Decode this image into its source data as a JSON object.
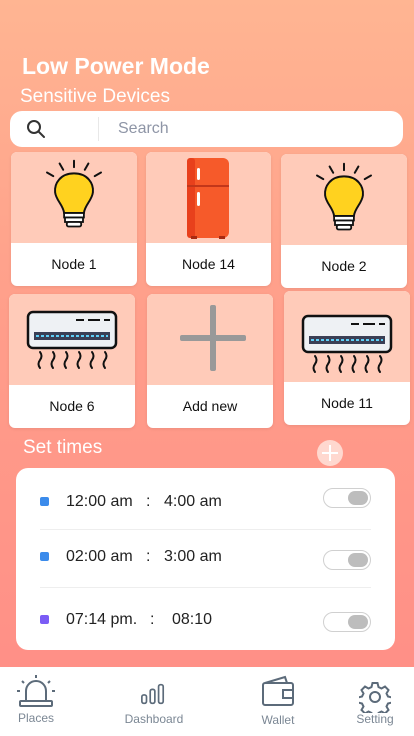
{
  "header": {
    "title": "Low Power Mode",
    "subtitle": "Sensitive Devices"
  },
  "search": {
    "placeholder": "Search",
    "value": ""
  },
  "devices": [
    {
      "label": "Node 1",
      "icon": "lightbulb-icon"
    },
    {
      "label": "Node 14",
      "icon": "refrigerator-icon"
    },
    {
      "label": "Node 2",
      "icon": "lightbulb-icon"
    },
    {
      "label": "Node 6",
      "icon": "air-conditioner-icon"
    },
    {
      "label": "Add new",
      "icon": "plus-icon"
    },
    {
      "label": "Node 11",
      "icon": "air-conditioner-icon"
    }
  ],
  "schedule": {
    "title": "Set times",
    "add_icon": "plus-circle-icon",
    "rows": [
      {
        "start": "12:00 am",
        "separator": ":",
        "end": "4:00 am",
        "color": "#3b8beb",
        "enabled": false
      },
      {
        "start": "02:00 am",
        "separator": ":",
        "end": "3:00 am",
        "color": "#3b8beb",
        "enabled": false
      },
      {
        "start": "07:14 pm.",
        "separator": ":",
        "end": "08:10",
        "color": "#7b5cf5",
        "enabled": false
      }
    ]
  },
  "tabs": [
    {
      "label": "Places",
      "icon": "alarm-light-icon"
    },
    {
      "label": "Dashboard",
      "icon": "bar-chart-icon"
    },
    {
      "label": "Wallet",
      "icon": "wallet-icon"
    },
    {
      "label": "Setting",
      "icon": "gear-icon"
    }
  ],
  "colors": {
    "background_top": "#ffb592",
    "background_bottom": "#ff8d86",
    "card_top": "#ffcbb9",
    "bulb": "#ffd21f",
    "fridge": "#f65a2a"
  }
}
